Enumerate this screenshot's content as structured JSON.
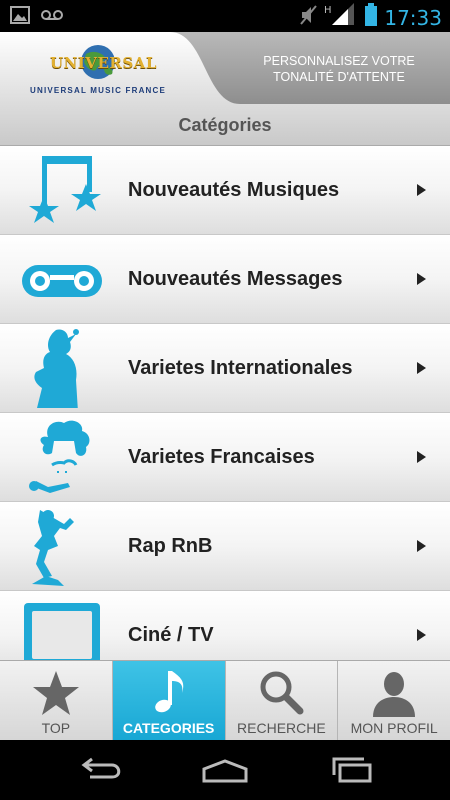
{
  "status": {
    "time": "17:33",
    "network": "H",
    "icons": [
      "image-icon",
      "voicemail-icon",
      "mute-icon",
      "signal-icon",
      "battery-icon"
    ]
  },
  "header": {
    "logo_text": "UNIVERSAL",
    "logo_subtitle": "UNIVERSAL MUSIC FRANCE",
    "promo_text": "PERSONNALISEZ VOTRE TONALITÉ D'ATTENTE"
  },
  "page": {
    "title": "Catégories"
  },
  "categories": [
    {
      "label": "Nouveautés Musiques",
      "icon": "music-stars-icon"
    },
    {
      "label": "Nouveautés Messages",
      "icon": "tape-icon"
    },
    {
      "label": "Varietes Internationales",
      "icon": "singer-icon"
    },
    {
      "label": "Varietes Francaises",
      "icon": "french-singer-icon"
    },
    {
      "label": "Rap RnB",
      "icon": "breakdancer-icon"
    },
    {
      "label": "Ciné / TV",
      "icon": "tv-icon"
    }
  ],
  "tabs": [
    {
      "label": "TOP",
      "icon": "star-icon",
      "active": false
    },
    {
      "label": "CATEGORIES",
      "icon": "music-note-icon",
      "active": true
    },
    {
      "label": "RECHERCHE",
      "icon": "magnifier-icon",
      "active": false
    },
    {
      "label": "MON PROFIL",
      "icon": "profile-icon",
      "active": false
    }
  ],
  "colors": {
    "accent": "#33b5e5",
    "icon_blue": "#1fa9d6",
    "active_tab": "#2bb6dd"
  }
}
